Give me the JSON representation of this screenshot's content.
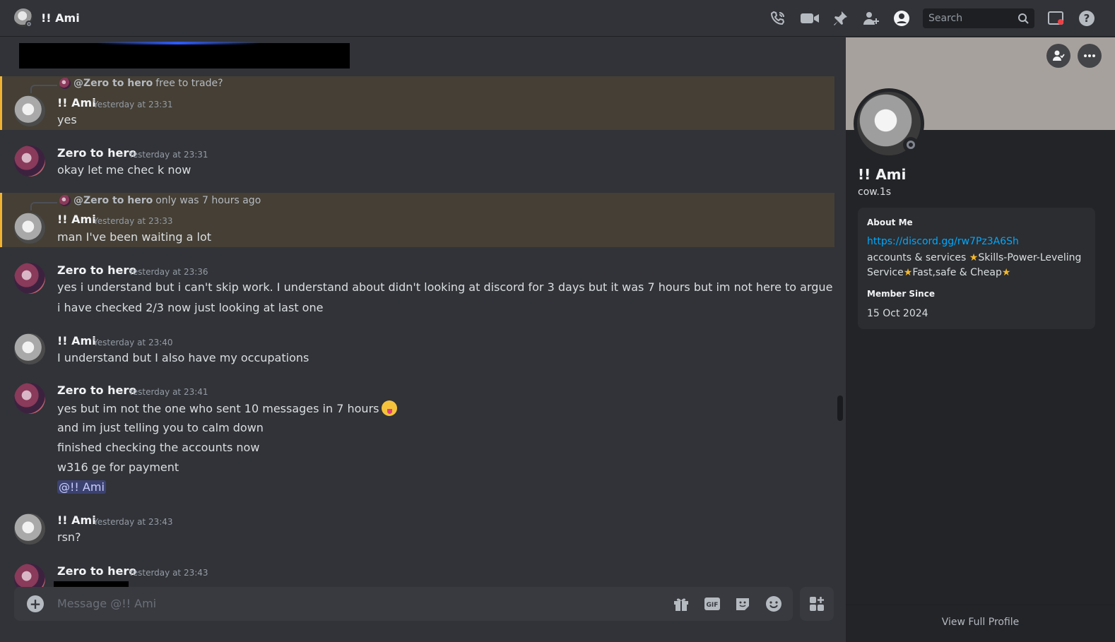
{
  "header": {
    "title": "!! Ami",
    "search_placeholder": "Search",
    "icons": [
      "phone-call-icon",
      "video-call-icon",
      "pin-icon",
      "add-friend-icon",
      "user-profile-icon",
      "search-icon",
      "inbox-icon",
      "help-icon"
    ]
  },
  "messages": [
    {
      "reply_to": "@Zero to hero",
      "reply_text": "free to trade?",
      "author": "!! Ami",
      "time": "Yesterday at 23:31",
      "lines": [
        "yes"
      ]
    },
    {
      "author": "Zero to hero",
      "time": "Yesterday at 23:31",
      "lines": [
        "okay let me chec k now"
      ]
    },
    {
      "reply_to": "@Zero to hero",
      "reply_text": "only was 7 hours ago",
      "author": "!! Ami",
      "time": "Yesterday at 23:33",
      "lines": [
        "man I've been waiting a lot"
      ]
    },
    {
      "author": "Zero to hero",
      "time": "Yesterday at 23:36",
      "lines": [
        "yes i understand but i can't skip work. I understand about didn't looking at discord for 3 days but it was 7 hours but im not here to argue",
        "i have checked 2/3 now just looking at last one"
      ]
    },
    {
      "author": "!! Ami",
      "time": "Yesterday at 23:40",
      "lines": [
        "I understand but I also have my occupations"
      ]
    },
    {
      "author": "Zero to hero",
      "time": "Yesterday at 23:41",
      "lines": [
        "yes but im not the one who sent 10 messages in 7 hours",
        "and im just telling you to calm down",
        "finished checking the accounts now",
        "w316 ge for payment"
      ],
      "mention": "@!! Ami"
    },
    {
      "author": "!! Ami",
      "time": "Yesterday at 23:43",
      "lines": [
        "rsn?"
      ]
    },
    {
      "author": "Zero to hero",
      "time": "Yesterday at 23:43",
      "lines": []
    }
  ],
  "composer": {
    "placeholder": "Message @!! Ami",
    "icons": [
      "add-icon",
      "gift-icon",
      "gif-icon",
      "sticker-icon",
      "emoji-icon",
      "apps-icon"
    ]
  },
  "profile": {
    "display_name": "!! Ami",
    "username": "cow.1s",
    "about_me_label": "About Me",
    "about_link": "https://discord.gg/rw7Pz3A6Sh",
    "bio_part1": "accounts & services ",
    "bio_part2": "Skills-Power-Leveling Service",
    "bio_part3": "Fast,safe & Cheap",
    "member_since_label": "Member Since",
    "member_since": "15 Oct 2024",
    "footer": "View Full Profile"
  },
  "colors": {
    "background": "#313338",
    "highlight": "#453f35",
    "highlight_bar": "#f0b232",
    "link": "#00a8fc",
    "mention_bg": "#3c4270"
  }
}
